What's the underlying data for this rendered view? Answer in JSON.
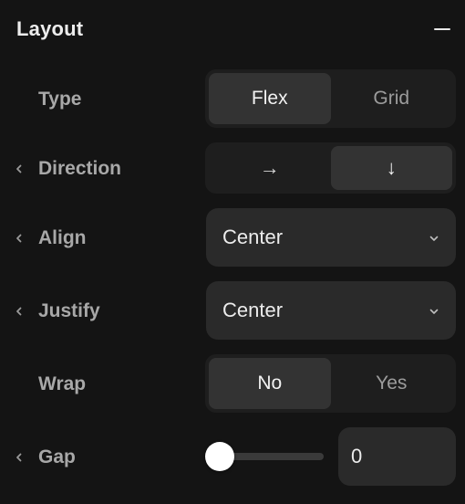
{
  "panel": {
    "title": "Layout",
    "collapse_icon": "minus-icon"
  },
  "rows": {
    "type": {
      "label": "Type",
      "options": [
        "Flex",
        "Grid"
      ],
      "selected": "Flex"
    },
    "direction": {
      "label": "Direction",
      "options": [
        {
          "icon": "arrow-right-icon",
          "glyph": "→"
        },
        {
          "icon": "arrow-down-icon",
          "glyph": "↓"
        }
      ],
      "selected": "arrow-down-icon"
    },
    "align": {
      "label": "Align",
      "value": "Center"
    },
    "justify": {
      "label": "Justify",
      "value": "Center"
    },
    "wrap": {
      "label": "Wrap",
      "options": [
        "No",
        "Yes"
      ],
      "selected": "No"
    },
    "gap": {
      "label": "Gap",
      "value": "0",
      "slider_fraction": 0
    }
  },
  "colors": {
    "background": "#141414",
    "control_bg": "#2a2a2a",
    "segment_bg": "#1e1e1e",
    "segment_active": "#333333",
    "label": "#a8a8a8",
    "text": "#ececec"
  }
}
